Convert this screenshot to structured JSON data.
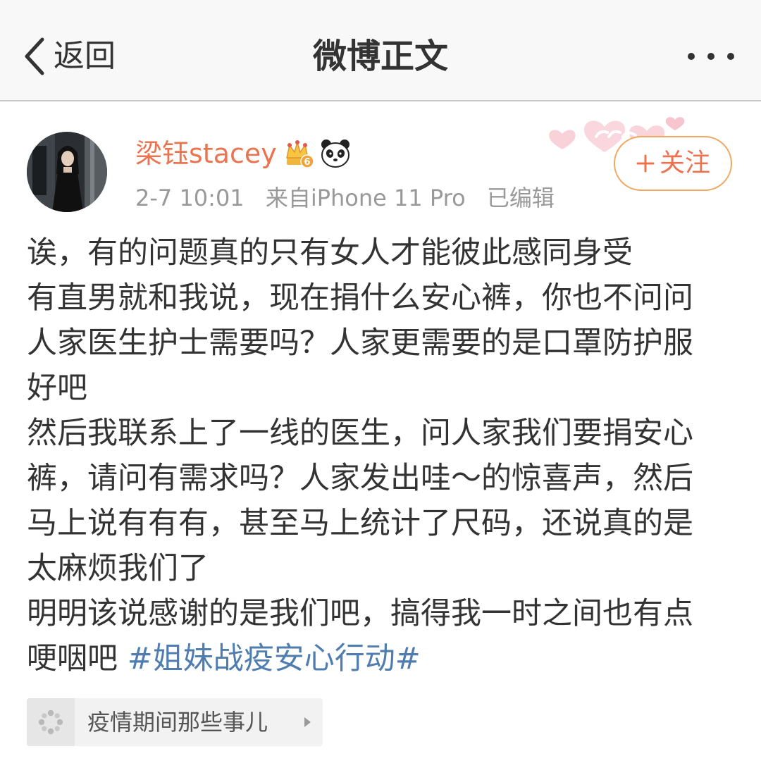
{
  "nav": {
    "back_label": "返回",
    "title": "微博正文"
  },
  "author": {
    "name": "梁钰stacey",
    "crown_level": "6",
    "time": "2-7 10:01",
    "source": "来自iPhone 11 Pro",
    "edited": "已编辑",
    "follow_label": "关注"
  },
  "post": {
    "lines": [
      "诶，有的问题真的只有女人才能彼此感同身受",
      "有直男就和我说，现在捐什么安心裤，你也不问问",
      "人家医生护士需要吗？人家更需要的是口罩防护服",
      "好吧",
      "然后我联系上了一线的医生，问人家我们要捐安心",
      "裤，请问有需求吗？人家发出哇～的惊喜声，然后",
      "马上说有有有，甚至马上统计了尺码，还说真的是",
      "太麻烦我们了",
      "明明该说感谢的是我们吧，搞得我一时之间也有点"
    ],
    "last_line_text": "哽咽吧 ",
    "hashtag": "#姐妹战疫安心行动#"
  },
  "topic": {
    "label": "疫情期间那些事儿",
    "icon": "topic-flower-icon"
  },
  "colors": {
    "username": "#eb7350",
    "hashtag": "#507daf",
    "body_text": "#333333",
    "meta_text": "#999999",
    "follow_border": "#f0a860"
  }
}
